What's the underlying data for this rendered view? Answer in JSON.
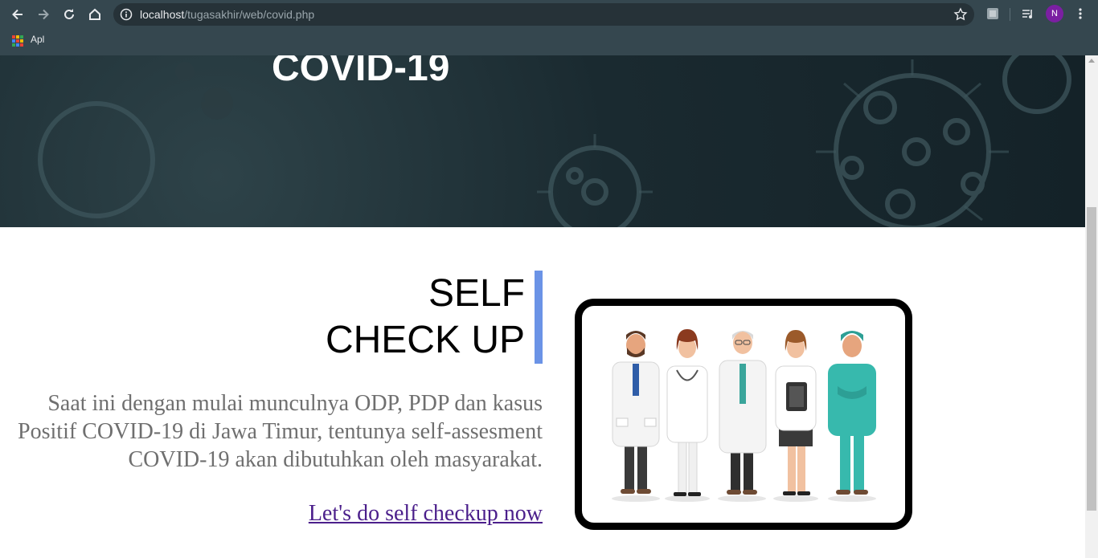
{
  "browser": {
    "url_host": "localhost",
    "url_path": "/tugasakhir/web/covid.php",
    "profile_initial": "N",
    "bookmarks": {
      "apps_label": "Apl"
    },
    "icons": [
      "back-icon",
      "forward-icon",
      "reload-icon",
      "home-icon",
      "info-icon",
      "star-icon",
      "extension-icon",
      "media-icon",
      "menu-icon",
      "apps-grid-icon"
    ]
  },
  "hero": {
    "title": "COVID-19"
  },
  "section": {
    "heading_line1": "SELF",
    "heading_line2": "CHECK UP",
    "paragraph": "Saat ini dengan mulai munculnya ODP, PDP dan kasus Positif COVID-19 di Jawa Timur, tentunya self-assesment COVID-19 akan dibutuhkan oleh masyarakat.",
    "cta_link": "Let's do self checkup now"
  },
  "colors": {
    "chrome": "#35474f",
    "accent_bar": "#6b93e6",
    "link": "#4b1f8b",
    "paragraph": "#6f6f6f",
    "scrub_teal": "#37b9ad"
  }
}
